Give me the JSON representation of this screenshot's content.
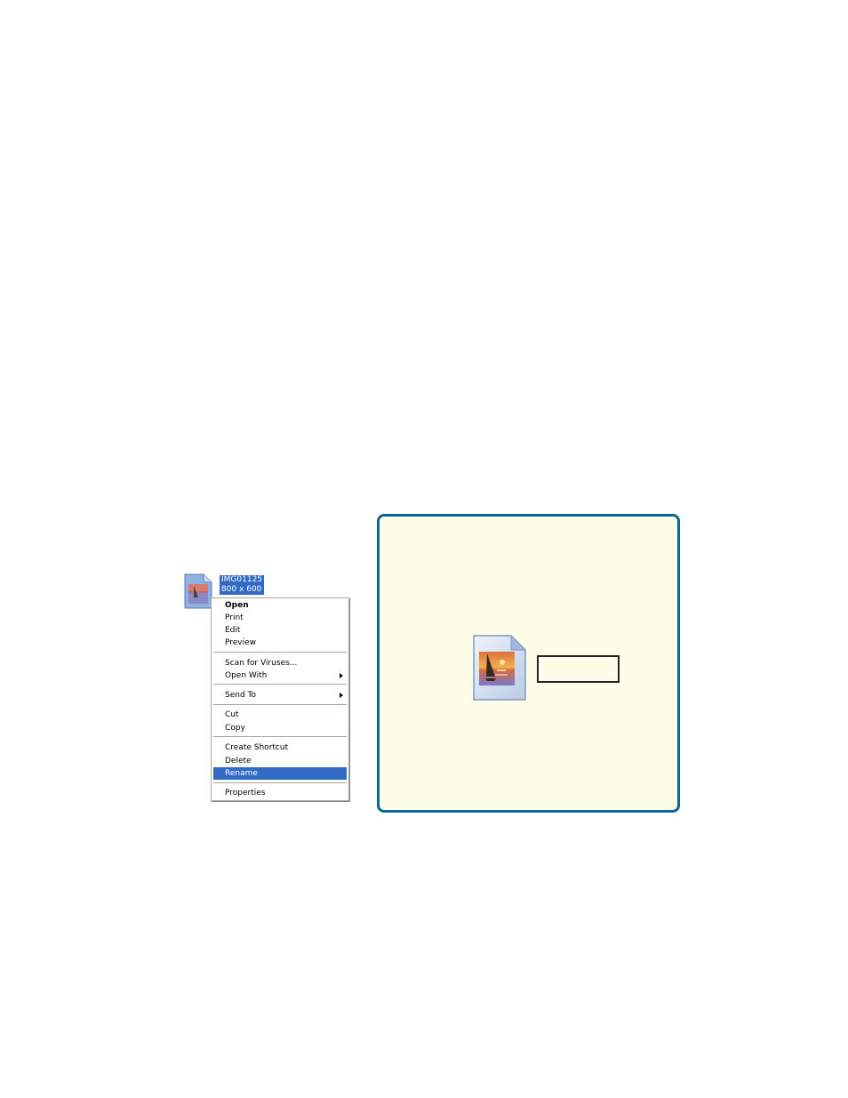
{
  "file": {
    "name": "IMG01125",
    "dimensions": "800 x 600",
    "icon": "image-file-icon"
  },
  "context_menu": {
    "items": [
      {
        "label": "Open",
        "bold": true
      },
      {
        "label": "Print"
      },
      {
        "label": "Edit"
      },
      {
        "label": "Preview"
      },
      {
        "label": "Scan for Viruses..."
      },
      {
        "label": "Open With",
        "submenu": true
      },
      {
        "label": "Send To",
        "submenu": true
      },
      {
        "label": "Cut"
      },
      {
        "label": "Copy"
      },
      {
        "label": "Create Shortcut"
      },
      {
        "label": "Delete"
      },
      {
        "label": "Rename",
        "selected": true
      },
      {
        "label": "Properties"
      }
    ]
  },
  "callout": {
    "rename_field_value": "",
    "icon": "image-file-icon",
    "background_color": "#fffde8",
    "border_color": "#0a6696"
  },
  "colors": {
    "selection": "#316ac5"
  }
}
